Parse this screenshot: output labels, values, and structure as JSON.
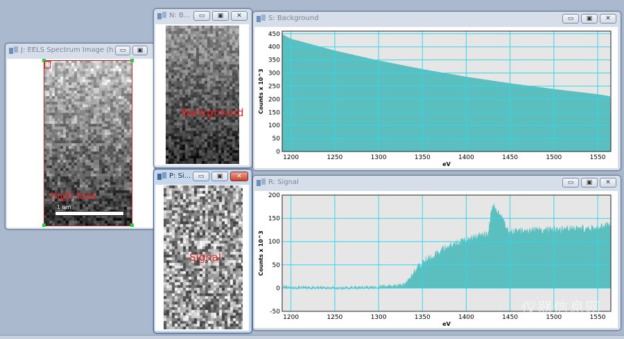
{
  "windows": {
    "eels": {
      "title": "J: EELS Spectrum Image (h...",
      "overlay": "high loss",
      "scalebar": "1 nm",
      "marker": "1"
    },
    "bgimg": {
      "title": "N: B...",
      "overlay": "Background"
    },
    "sigimg": {
      "title": "P: Si...",
      "overlay": "Signal"
    },
    "bgspec": {
      "title": "S: Background",
      "ylabel": "Counts x 10^3",
      "xlabel": "eV"
    },
    "sigspec": {
      "title": "R: Signal",
      "ylabel": "Counts x 10^3",
      "xlabel": "eV"
    }
  },
  "buttons": {
    "minimize": "▭",
    "restore": "▣",
    "close": "✕"
  },
  "watermark": "仪器信息网",
  "chart_data": [
    {
      "type": "area",
      "title": "S: Background",
      "xlabel": "eV",
      "ylabel": "Counts x 10^3",
      "xlim": [
        1190,
        1565
      ],
      "ylim": [
        0,
        460
      ],
      "xticks": [
        1200,
        1250,
        1300,
        1350,
        1400,
        1450,
        1500,
        1550
      ],
      "yticks": [
        0,
        50,
        100,
        150,
        200,
        250,
        300,
        350,
        400,
        450
      ],
      "series": [
        {
          "x": [
            1190,
            1200,
            1250,
            1300,
            1350,
            1400,
            1450,
            1500,
            1550,
            1565
          ],
          "values": [
            447,
            430,
            385,
            347,
            314,
            285,
            260,
            238,
            218,
            210
          ]
        }
      ],
      "color": "#5bbfbf",
      "grid": true
    },
    {
      "type": "area",
      "title": "R: Signal",
      "xlabel": "eV",
      "ylabel": "Counts x 10^3",
      "xlim": [
        1190,
        1565
      ],
      "ylim": [
        -50,
        200
      ],
      "xticks": [
        1200,
        1250,
        1300,
        1350,
        1400,
        1450,
        1500,
        1550
      ],
      "yticks": [
        -50,
        0,
        50,
        100,
        150,
        200
      ],
      "series": [
        {
          "x": [
            1190,
            1250,
            1300,
            1320,
            1330,
            1335,
            1350,
            1375,
            1400,
            1425,
            1430,
            1450,
            1500,
            1550,
            1565
          ],
          "values": [
            2,
            0,
            2,
            5,
            8,
            20,
            55,
            85,
            105,
            115,
            180,
            120,
            125,
            128,
            135
          ]
        }
      ],
      "color": "#5bbfbf",
      "grid": true
    }
  ]
}
